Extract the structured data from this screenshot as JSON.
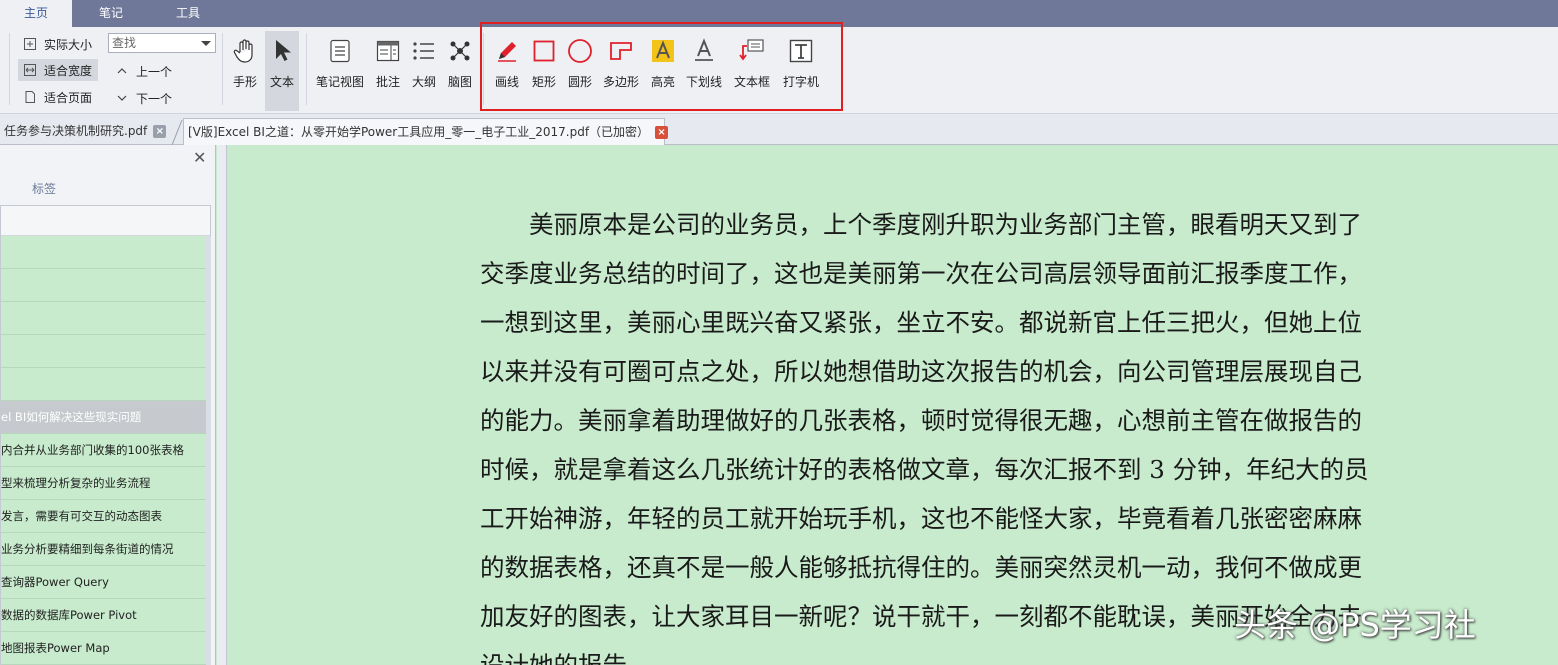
{
  "menu": {
    "tabs": [
      "主页",
      "笔记",
      "工具"
    ]
  },
  "ribbon": {
    "actual_size": "实际大小",
    "fit_width": "适合宽度",
    "fit_page": "适合页面",
    "search_placeholder": "查找",
    "prev": "上一个",
    "next": "下一个",
    "hand": "手形",
    "text": "文本",
    "note_view": "笔记视图",
    "annotate": "批注",
    "outline": "大纲",
    "mindmap": "脑图",
    "draw_line": "画线",
    "rectangle": "矩形",
    "circle": "圆形",
    "polygon": "多边形",
    "highlight": "高亮",
    "underline": "下划线",
    "textbox": "文本框",
    "typewriter": "打字机"
  },
  "doc_tabs": [
    {
      "label": "任务参与决策机制研究.pdf"
    },
    {
      "label": "[V版]Excel BI之道：从零开始学Power工具应用_零一_电子工业_2017.pdf（已加密）"
    }
  ],
  "left_panel": {
    "tab_label": "标签",
    "items": [
      "",
      "",
      "",
      "",
      "",
      "el BI如何解决这些现实问题",
      "内合并从业务部门收集的100张表格",
      "型来梳理分析复杂的业务流程",
      "发言，需要有可交互的动态图表",
      "业务分析要精细到每条街道的情况",
      "查询器Power Query",
      "数据的数据库Power Pivot",
      "地图报表Power Map"
    ]
  },
  "document": {
    "lines": [
      "　　美丽原本是公司的业务员，上个季度刚升职为业务部门主管，眼看明天又到了",
      "交季度业务总结的时间了，这也是美丽第一次在公司高层领导面前汇报季度工作，",
      "一想到这里，美丽心里既兴奋又紧张，坐立不安。都说新官上任三把火，但她上位",
      "以来并没有可圈可点之处，所以她想借助这次报告的机会，向公司管理层展现自己",
      "的能力。美丽拿着助理做好的几张表格，顿时觉得很无趣，心想前主管在做报告的",
      "时候，就是拿着这么几张统计好的表格做文章，每次汇报不到 3 分钟，年纪大的员",
      "工开始神游，年轻的员工就开始玩手机，这也不能怪大家，毕竟看着几张密密麻麻",
      "的数据表格，还真不是一般人能够抵抗得住的。美丽突然灵机一动，我何不做成更",
      "加友好的图表，让大家耳目一新呢？说干就干，一刻都不能耽误，美丽开始全力去",
      "设计她的报告。"
    ]
  },
  "watermark": "头条 @PS学习社",
  "colors": {
    "menubar": "#6f7899",
    "page_bg": "#c7ebcc",
    "highlight_box": "#e02020",
    "annot_red": "#e0202a",
    "annot_yellow": "#f3c317"
  }
}
